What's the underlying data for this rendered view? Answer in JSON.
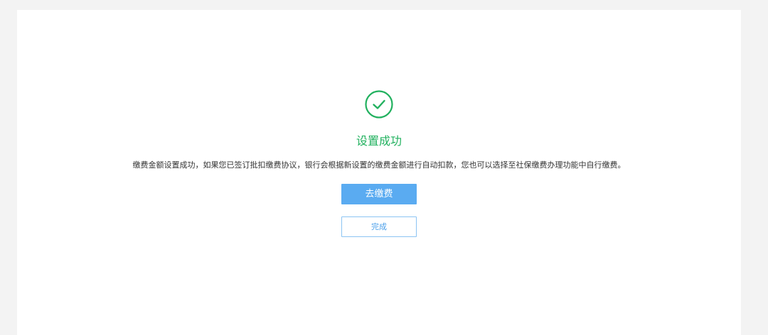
{
  "result": {
    "icon": "check-circle-icon",
    "title": "设置成功",
    "message": "缴费金额设置成功，如果您已签订批扣缴费协议，银行会根据新设置的缴费金额进行自动扣款，您也可以选择至社保缴费办理功能中自行缴费。"
  },
  "actions": {
    "pay_label": "去缴费",
    "done_label": "完成"
  },
  "colors": {
    "success": "#22b15f",
    "primary": "#5aabf1",
    "primary_text": "#4a9fea",
    "background": "#f3f3f3"
  }
}
